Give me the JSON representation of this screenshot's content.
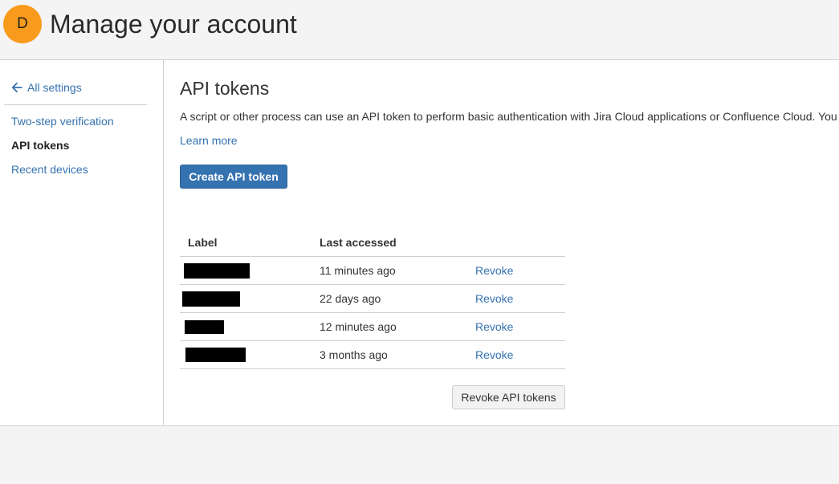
{
  "header": {
    "avatar_initial": "D",
    "title": "Manage your account"
  },
  "sidebar": {
    "back_label": "All settings",
    "items": [
      {
        "label": "Two-step verification",
        "active": false
      },
      {
        "label": "API tokens",
        "active": true
      },
      {
        "label": "Recent devices",
        "active": false
      }
    ]
  },
  "main": {
    "title": "API tokens",
    "description": "A script or other process can use an API token to perform basic authentication with Jira Cloud applications or Confluence Cloud. You",
    "learn_more": "Learn more",
    "create_button": "Create API token",
    "table": {
      "headers": [
        "Label",
        "Last accessed",
        ""
      ],
      "rows": [
        {
          "label": "[redacted]",
          "last_accessed": "11 minutes ago",
          "action": "Revoke"
        },
        {
          "label": "[redacted]",
          "last_accessed": "22 days ago",
          "action": "Revoke"
        },
        {
          "label": "[redacted]",
          "last_accessed": "12 minutes ago",
          "action": "Revoke"
        },
        {
          "label": "[redacted]",
          "last_accessed": "3 months ago",
          "action": "Revoke"
        }
      ]
    },
    "revoke_all_button": "Revoke API tokens"
  },
  "colors": {
    "avatar": "#f89b1c",
    "link": "#3572b0",
    "primary_button": "#3572b0",
    "redaction": "#000000"
  }
}
